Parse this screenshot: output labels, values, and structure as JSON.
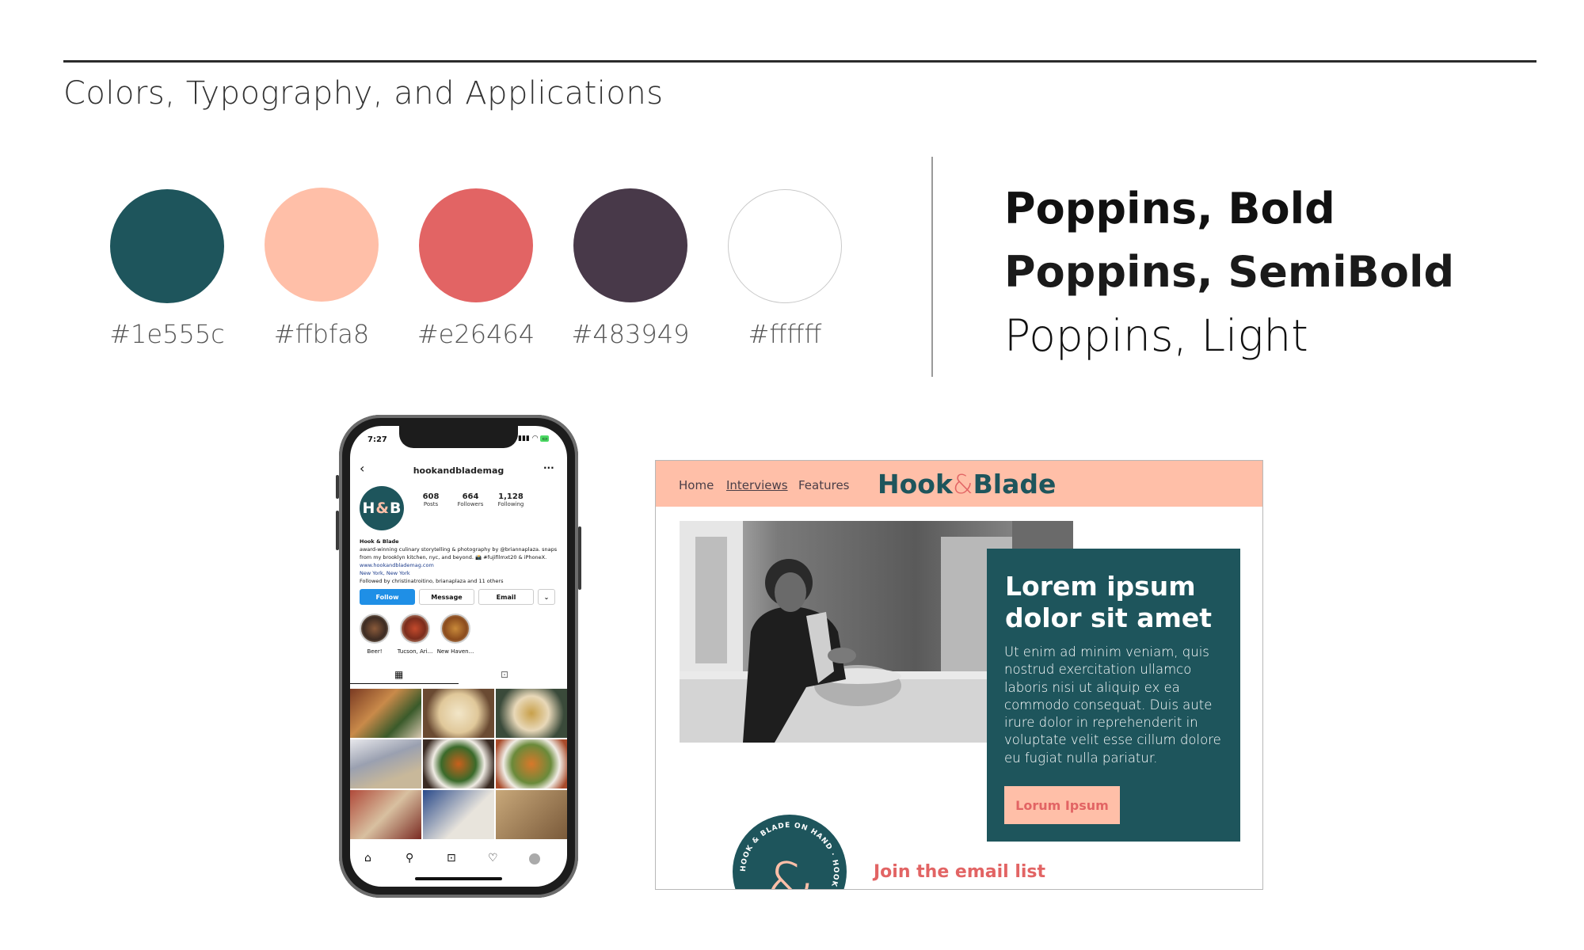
{
  "page_title": "Colors, Typography, and Applications",
  "swatches": [
    {
      "hex": "#1e555c",
      "label": "#1e555c"
    },
    {
      "hex": "#ffbfa8",
      "label": "#ffbfa8"
    },
    {
      "hex": "#e26464",
      "label": "#e26464"
    },
    {
      "hex": "#483949",
      "label": "#483949"
    },
    {
      "hex": "#ffffff",
      "label": "#ffffff"
    }
  ],
  "fonts": {
    "bold": "Poppins, Bold",
    "semibold": "Poppins, SemiBold",
    "light": "Poppins, Light"
  },
  "phone": {
    "time": "7:27",
    "username": "hookandblademag",
    "avatar_left": "H",
    "avatar_amp": "&",
    "avatar_right": "B",
    "stats": [
      {
        "value": "608",
        "label": "Posts"
      },
      {
        "value": "664",
        "label": "Followers"
      },
      {
        "value": "1,128",
        "label": "Following"
      }
    ],
    "bio_name": "Hook & Blade",
    "bio_line1": "award-winning culinary storytelling & photography by @briannaplaza. snaps",
    "bio_line2": "from my brooklyn kitchen, nyc, and beyond. 📸 #fujifilmxt20 & iPhoneX.",
    "bio_link": "www.hookandblademag.com",
    "bio_location": "New York, New York",
    "bio_followed": "Followed by christinatroitino, brianaplaza and 11 others",
    "buttons": {
      "follow": "Follow",
      "message": "Message",
      "email": "Email"
    },
    "highlights": [
      "Beer!",
      "Tucson, Ari...",
      "New Haven..."
    ]
  },
  "site": {
    "nav": {
      "home": "Home",
      "interviews": "Interviews",
      "features": "Features"
    },
    "logo_left": "Hook",
    "logo_amp": "&",
    "logo_right": "Blade",
    "card_heading": "Lorem ipsum dolor sit amet",
    "card_body": "Ut enim ad minim veniam, quis nostrud exercitation ullamco laboris nisi ut aliquip ex ea commodo consequat. Duis aute irure dolor in reprehenderit in voluptate velit esse cillum dolore eu fugiat nulla pariatur.",
    "card_button": "Lorum Ipsum",
    "badge_text": "HOOK & BLADE ON HAND · HOOK & BLADE ON HAND ·",
    "join_text": "Join the email list"
  }
}
